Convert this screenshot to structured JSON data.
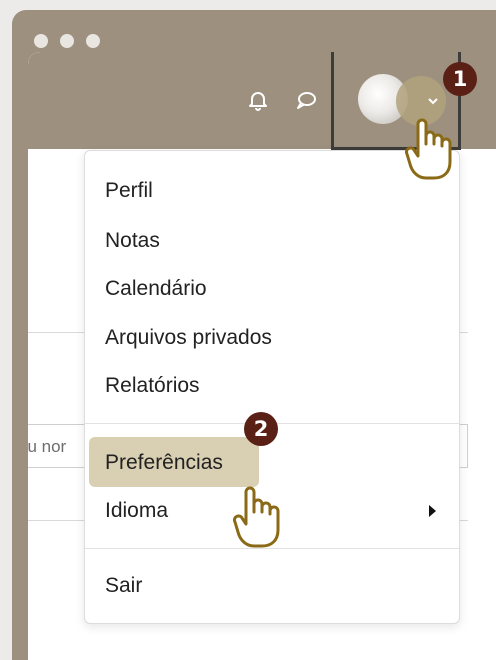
{
  "menu": {
    "profile": "Perfil",
    "notes": "Notas",
    "calendar": "Calendário",
    "private_files": "Arquivos privados",
    "reports": "Relatórios",
    "preferences": "Preferências",
    "language": "Idioma",
    "logout": "Sair"
  },
  "background": {
    "input_text": "ou nor"
  },
  "steps": {
    "step1": "1",
    "step2": "2"
  },
  "icons": {
    "notification": "bell-icon",
    "messages": "chat-bubble-icon",
    "caret": "chevron-down-icon",
    "pointer": "hand-pointer-icon",
    "submenu": "triangle-right-icon"
  },
  "colors": {
    "frame": "#9d907f",
    "highlight": "#d9cfb2",
    "step_badge": "#5a2016",
    "hand_outline": "#8a6a16"
  }
}
